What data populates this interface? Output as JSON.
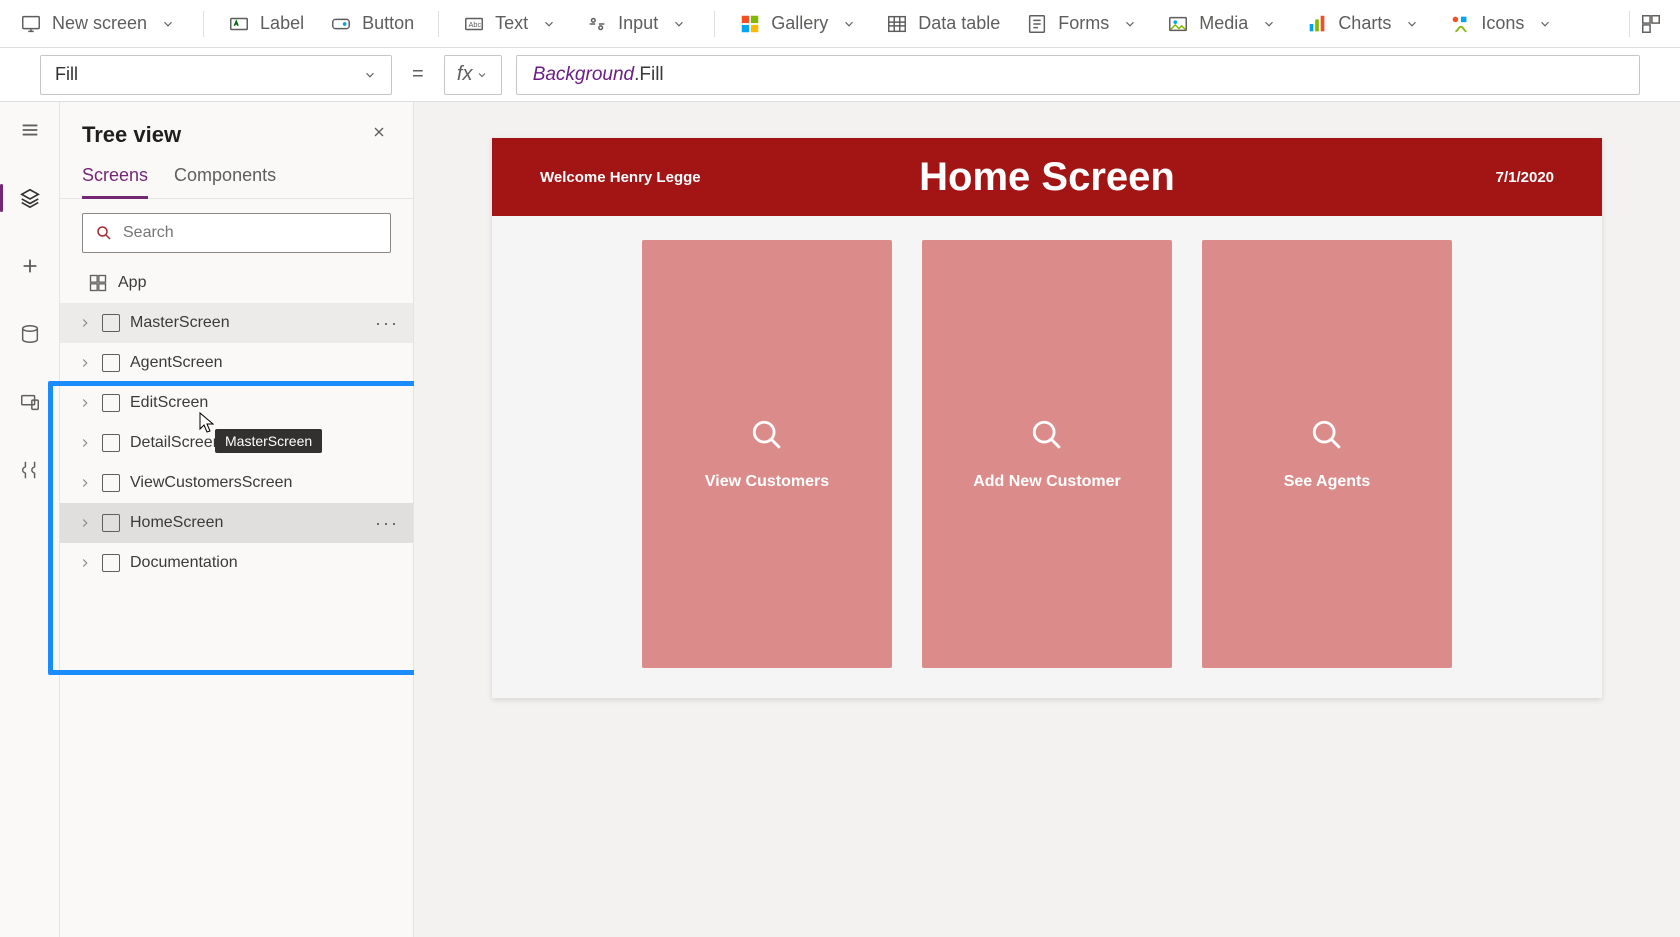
{
  "ribbon": {
    "new_screen": "New screen",
    "label": "Label",
    "button": "Button",
    "text": "Text",
    "input": "Input",
    "gallery": "Gallery",
    "data_table": "Data table",
    "forms": "Forms",
    "media": "Media",
    "charts": "Charts",
    "icons": "Icons"
  },
  "formula": {
    "property": "Fill",
    "equals": "=",
    "fx": "fx",
    "object": "Background",
    "dot": ".",
    "prop": "Fill"
  },
  "tree": {
    "title": "Tree view",
    "tabs": {
      "screens": "Screens",
      "components": "Components"
    },
    "search_placeholder": "Search",
    "app": "App",
    "items": [
      "MasterScreen",
      "AgentScreen",
      "EditScreen",
      "DetailScreen",
      "ViewCustomersScreen",
      "HomeScreen",
      "Documentation"
    ],
    "tooltip": "MasterScreen"
  },
  "canvas": {
    "welcome": "Welcome Henry Legge",
    "title": "Home Screen",
    "date": "7/1/2020",
    "cards": [
      "View Customers",
      "Add New Customer",
      "See Agents"
    ]
  },
  "colors": {
    "brand_red": "#a31515",
    "card_pink": "#dc8b8b",
    "highlight_blue": "#1a8cff",
    "accent_purple": "#742774"
  }
}
